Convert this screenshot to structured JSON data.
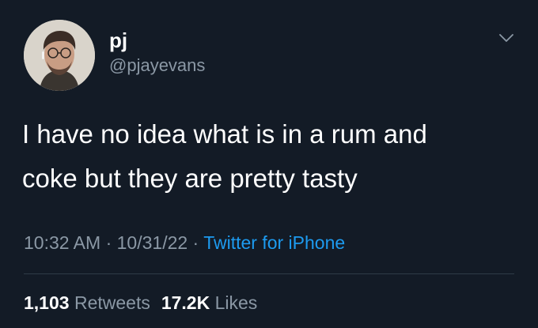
{
  "author": {
    "display_name": "pj",
    "handle": "@pjayevans"
  },
  "tweet": {
    "text_line1": "I have no idea what is in a rum and",
    "text_line2": "coke but they are pretty tasty"
  },
  "meta": {
    "time": "10:32 AM",
    "separator": " · ",
    "date": "10/31/22",
    "source": "Twitter for iPhone"
  },
  "stats": {
    "retweets_count": "1,103",
    "retweets_label": "Retweets",
    "likes_count": "17.2K",
    "likes_label": "Likes"
  },
  "icons": {
    "menu": "chevron-down-icon",
    "avatar": "avatar"
  },
  "colors": {
    "background": "#131b26",
    "text_primary": "#ffffff",
    "text_secondary": "#8b98a5",
    "link": "#1d9bf0",
    "divider": "#2f3b47"
  }
}
